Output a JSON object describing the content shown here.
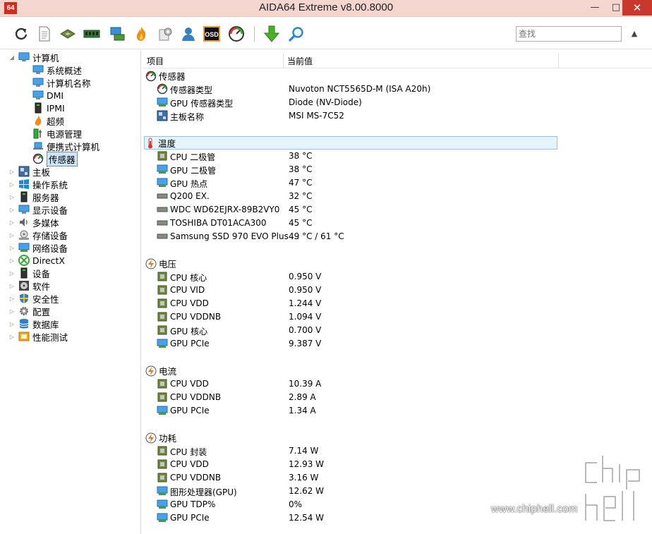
{
  "window": {
    "app_icon_text": "64",
    "title": "AIDA64 Extreme v8.00.8000",
    "min_glyph": "—",
    "max_glyph": "□",
    "close_glyph": "✕"
  },
  "toolbar": {
    "osd_label": "OSD",
    "search_placeholder": "查找",
    "scroll_glyph": "▲"
  },
  "tree": {
    "root": {
      "label": "计算机",
      "expander": "◢"
    },
    "children": [
      {
        "label": "系统概述"
      },
      {
        "label": "计算机名称"
      },
      {
        "label": "DMI"
      },
      {
        "label": "IPMI"
      },
      {
        "label": "超频"
      },
      {
        "label": "电源管理"
      },
      {
        "label": "便携式计算机"
      },
      {
        "label": "传感器"
      }
    ],
    "top_items": [
      {
        "label": "主板",
        "expander": "▷"
      },
      {
        "label": "操作系统",
        "expander": "▷"
      },
      {
        "label": "服务器",
        "expander": "▷"
      },
      {
        "label": "显示设备",
        "expander": "▷"
      },
      {
        "label": "多媒体",
        "expander": "▷"
      },
      {
        "label": "存储设备",
        "expander": "▷"
      },
      {
        "label": "网络设备",
        "expander": "▷"
      },
      {
        "label": "DirectX",
        "expander": "▷"
      },
      {
        "label": "设备",
        "expander": "▷"
      },
      {
        "label": "软件",
        "expander": "▷"
      },
      {
        "label": "安全性",
        "expander": "▷"
      },
      {
        "label": "配置",
        "expander": "▷"
      },
      {
        "label": "数据库",
        "expander": "▷"
      },
      {
        "label": "性能测试",
        "expander": "▷"
      }
    ]
  },
  "list": {
    "col_item": "项目",
    "col_value": "当前值",
    "groups": [
      {
        "title": "传感器",
        "rows": [
          {
            "label": "传感器类型",
            "value": "Nuvoton NCT5565D-M  (ISA A20h)"
          },
          {
            "label": "GPU 传感器类型",
            "value": "Diode  (NV-Diode)"
          },
          {
            "label": "主板名称",
            "value": "MSI MS-7C52"
          }
        ]
      },
      {
        "title": "温度",
        "rows": [
          {
            "label": "CPU 二极管",
            "value": "38 °C"
          },
          {
            "label": "GPU 二极管",
            "value": "38 °C"
          },
          {
            "label": "GPU 热点",
            "value": "47 °C"
          },
          {
            "label": "Q200 EX.",
            "value": "32 °C"
          },
          {
            "label": "WDC WD62EJRX-89B2VY0",
            "value": "45 °C"
          },
          {
            "label": "TOSHIBA DT01ACA300",
            "value": "45 °C"
          },
          {
            "label": "Samsung SSD 970 EVO Plus ...",
            "value": "49 °C / 61 °C"
          }
        ]
      },
      {
        "title": "电压",
        "rows": [
          {
            "label": "CPU 核心",
            "value": "0.950 V"
          },
          {
            "label": "CPU VID",
            "value": "0.950 V"
          },
          {
            "label": "CPU VDD",
            "value": "1.244 V"
          },
          {
            "label": "CPU VDDNB",
            "value": "1.094 V"
          },
          {
            "label": "GPU 核心",
            "value": "0.700 V"
          },
          {
            "label": "GPU PCIe",
            "value": "9.387 V"
          }
        ]
      },
      {
        "title": "电流",
        "rows": [
          {
            "label": "CPU VDD",
            "value": "10.39 A"
          },
          {
            "label": "CPU VDDNB",
            "value": "2.89 A"
          },
          {
            "label": "GPU PCIe",
            "value": "1.34 A"
          }
        ]
      },
      {
        "title": "功耗",
        "rows": [
          {
            "label": "CPU 封装",
            "value": "7.14 W"
          },
          {
            "label": "CPU VDD",
            "value": "12.93 W"
          },
          {
            "label": "CPU VDDNB",
            "value": "3.16 W"
          },
          {
            "label": "图形处理器(GPU)",
            "value": "12.62 W"
          },
          {
            "label": "GPU TDP%",
            "value": "0%"
          },
          {
            "label": "GPU PCIe",
            "value": "12.54 W"
          }
        ]
      }
    ]
  },
  "watermark": {
    "url": "www.chiphell.com",
    "logo_text": "chip hell"
  },
  "colors": {
    "titlebar": "#f5d6cf",
    "close": "#c7392c",
    "selection": "#cde6f7",
    "group_highlight": "#e5f3fb"
  }
}
